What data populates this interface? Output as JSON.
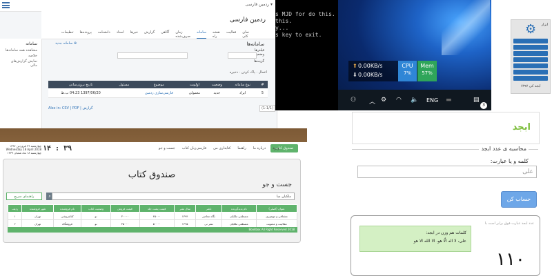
{
  "cms": {
    "user_menu": "▾ ردمین فارسی",
    "site_name": "ردمین فارسی",
    "menu": [
      "نمای کلی",
      "فعالیت",
      "نقشه راه",
      "سامانه",
      "زمان صرف‌شده",
      "آگاهی",
      "گزارش",
      "خبرها",
      "اسناد",
      "دانشنامه",
      "پرونده‌ها",
      "تنظیمات"
    ],
    "active_menu": "سامانه",
    "add_link": "سامانه جدید",
    "section_title": "سامانه‌ها",
    "filter_label": "فیلترها",
    "status_label": "وضعیت",
    "options_label": "گزینه‌ها",
    "toolbar": [
      "اعمال",
      "پاک کردن",
      "ذخیره"
    ],
    "sidebar": {
      "title": "سامانه",
      "items": [
        "مشاهده همه سامانه‌ها",
        "خلاصه",
        "نمایش گزارش‌های مالی"
      ]
    },
    "table": {
      "headers": [
        "#",
        "نوع سامانه",
        "وضعیت",
        "اولویت",
        "موضوع",
        "مسئول",
        "تاریخ بروزرسانی"
      ],
      "rows": [
        [
          "5",
          "ایراد",
          "جدید",
          "معمولی",
          "فارسی‌سازی ردمین",
          "",
          "1397/06/20 04:23 ب.ظ"
        ]
      ]
    },
    "export": "Also in: CSV | PDF | گزارش",
    "pager": "(1-1/1)"
  },
  "terminal": {
    "lines": [
      "s MJD for do this.",
      "this.",
      "y...",
      "s key to exit."
    ]
  },
  "windows": {
    "net_up": "0.00KB/s",
    "net_down": "0.00KB/s",
    "cpu_label": "CPU",
    "cpu_value": "7%",
    "mem_label": "Mem",
    "mem_value": "57%",
    "lang": "ENG",
    "notif_count": "3"
  },
  "widget": {
    "title": "ابزار",
    "footer": "ابجد کی ۱۳۹۷"
  },
  "abjad": {
    "title": "ابجد",
    "legend": "محاسبه ی عدد ابجد",
    "input_label": "کلمه و یا عبارت:",
    "input_value": "علی",
    "button": "حساب کن"
  },
  "result": {
    "hint": "عدد ابجد عبارت فوق برابر است با",
    "words_title": "کلمات هم وزن در ابجد:",
    "words": "علی، لا اله الّا هو، الا الله الا هو",
    "number": "۱۱۰"
  },
  "book": {
    "logo": "صندوق کتاب",
    "nav": [
      "جست و جو",
      "فارسی‌زبان کتاب",
      "کتابداری من",
      "راهنما",
      "درباره ما",
      "ورود"
    ],
    "clock": "۱۴ : ۳۹",
    "date_lines": [
      "چهارشنبه ۲۹ فروردین ۱۳۹۷",
      "Wednesday 18 April 2018",
      "چهارشنبه ۱۸ ماه شعبان ۱۴۳۹"
    ],
    "title": "صندوق کتاب",
    "search_heading": "جست و جو",
    "search_value": "ملکیان مبا",
    "guide_button": "راهنمای سریع",
    "table": {
      "headers": [
        "عنوان (اصلی)",
        "نام پدیدآورنده",
        "ناشر",
        "سال نشر",
        "قیمت پشت جلد",
        "قیمت فروش",
        "وضعیت کتاب",
        "نام فروشنده",
        "شهر فروشنده",
        "ردیف"
      ],
      "rows": [
        [
          "مشتاقی و مهجوری",
          "مصطفی ملکیان",
          "نگاه معاصر",
          "۱۳۹۴",
          "۴۵۰۰۰",
          "۳۰۰۰۰",
          "نو",
          "کتابفروشی",
          "تهران",
          "۱"
        ],
        [
          "عقلانیت و معنویت",
          "مصطفی ملکیان",
          "نشر نی",
          "۱۳۹۵",
          "۵۰۰۰۰",
          "۳۵۰۰۰",
          "نو",
          "فروشگاه",
          "تهران",
          "۲"
        ]
      ]
    },
    "footer": "Bookbox All Right Reserved 2018"
  }
}
